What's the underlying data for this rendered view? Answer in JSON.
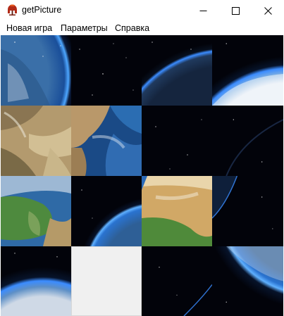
{
  "window": {
    "title": "getPicture",
    "controls": [
      "minimize",
      "maximize",
      "close"
    ]
  },
  "menu": {
    "items": [
      {
        "label": "Новая игра"
      },
      {
        "label": "Параметры"
      },
      {
        "label": "Справка"
      }
    ]
  },
  "board": {
    "rows": 4,
    "cols": 4,
    "empty_tile": {
      "row": 3,
      "col": 1
    },
    "image_subject": "earth-from-space",
    "tiles": [
      {
        "row": 0,
        "col": 0,
        "content": "earth-limb-left"
      },
      {
        "row": 0,
        "col": 1,
        "content": "starfield"
      },
      {
        "row": 0,
        "col": 2,
        "content": "earth-limb-dark"
      },
      {
        "row": 0,
        "col": 3,
        "content": "earth-clouds-top-right"
      },
      {
        "row": 1,
        "col": 0,
        "content": "earth-desert-terrain"
      },
      {
        "row": 1,
        "col": 1,
        "content": "earth-horn-of-africa"
      },
      {
        "row": 1,
        "col": 2,
        "content": "starfield"
      },
      {
        "row": 1,
        "col": 3,
        "content": "starfield-with-arc"
      },
      {
        "row": 2,
        "col": 0,
        "content": "earth-europe-green"
      },
      {
        "row": 2,
        "col": 1,
        "content": "earth-limb-blue"
      },
      {
        "row": 2,
        "col": 2,
        "content": "earth-sahara"
      },
      {
        "row": 2,
        "col": 3,
        "content": "earth-limb-right-dark"
      },
      {
        "row": 3,
        "col": 0,
        "content": "earth-bottom-left-clouds"
      },
      {
        "row": 3,
        "col": 1,
        "content": "empty"
      },
      {
        "row": 3,
        "col": 2,
        "content": "starfield-limb-bottom"
      },
      {
        "row": 3,
        "col": 3,
        "content": "earth-limb-bottom-right"
      }
    ]
  },
  "colors": {
    "space": "#02030a",
    "atmosphere": "#3b8cff",
    "empty_slot": "#f0f0f0"
  }
}
